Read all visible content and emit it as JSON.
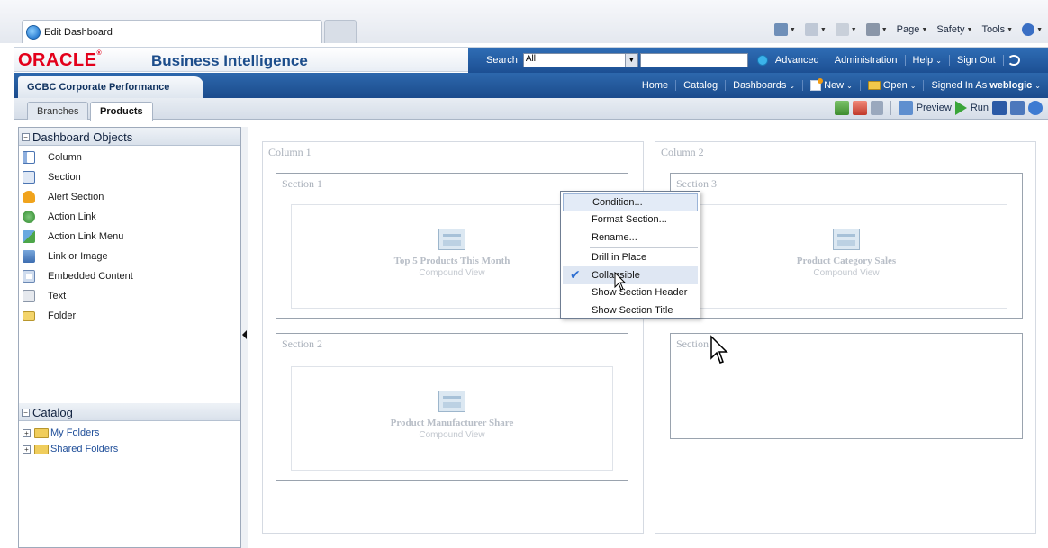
{
  "browser": {
    "tab_title": "Edit Dashboard",
    "commands": [
      "Page",
      "Safety",
      "Tools"
    ]
  },
  "header": {
    "logo": "ORACLE",
    "product": "Business Intelligence",
    "search_label": "Search",
    "search_scope": "All",
    "links": [
      "Advanced",
      "Administration",
      "Help",
      "Sign Out"
    ]
  },
  "bar2": {
    "dashboard_title": "GCBC Corporate Performance",
    "nav": {
      "home": "Home",
      "catalog": "Catalog",
      "dashboards": "Dashboards",
      "new": "New",
      "open": "Open",
      "signed_in": "Signed In As",
      "user": "weblogic"
    }
  },
  "tabs": {
    "branches": "Branches",
    "products": "Products"
  },
  "toolbar": {
    "preview": "Preview",
    "run": "Run"
  },
  "left": {
    "objects_title": "Dashboard Objects",
    "objects": [
      {
        "label": "Column",
        "icon": "column-icon"
      },
      {
        "label": "Section",
        "icon": "section-icon"
      },
      {
        "label": "Alert Section",
        "icon": "alert-icon"
      },
      {
        "label": "Action Link",
        "icon": "action-link-icon"
      },
      {
        "label": "Action Link Menu",
        "icon": "action-link-menu-icon"
      },
      {
        "label": "Link or Image",
        "icon": "link-image-icon"
      },
      {
        "label": "Embedded Content",
        "icon": "embedded-content-icon"
      },
      {
        "label": "Text",
        "icon": "text-icon"
      },
      {
        "label": "Folder",
        "icon": "folder-icon"
      }
    ],
    "catalog_title": "Catalog",
    "catalog": [
      "My Folders",
      "Shared Folders"
    ]
  },
  "canvas": {
    "column1": "Column 1",
    "column2": "Column 2",
    "section1": "Section 1",
    "section2": "Section 2",
    "section3": "Section 3",
    "section4": "Section 4",
    "view1": {
      "title": "Top 5 Products This Month",
      "sub": "Compound View"
    },
    "view2": {
      "title": "Product Manufacturer Share",
      "sub": "Compound View"
    },
    "view3": {
      "title": "Product Category Sales",
      "sub": "Compound View"
    }
  },
  "context_menu": {
    "items": [
      "Condition...",
      "Format Section...",
      "Rename...",
      "Drill in Place",
      "Collapsible",
      "Show Section Header",
      "Show Section Title"
    ]
  }
}
